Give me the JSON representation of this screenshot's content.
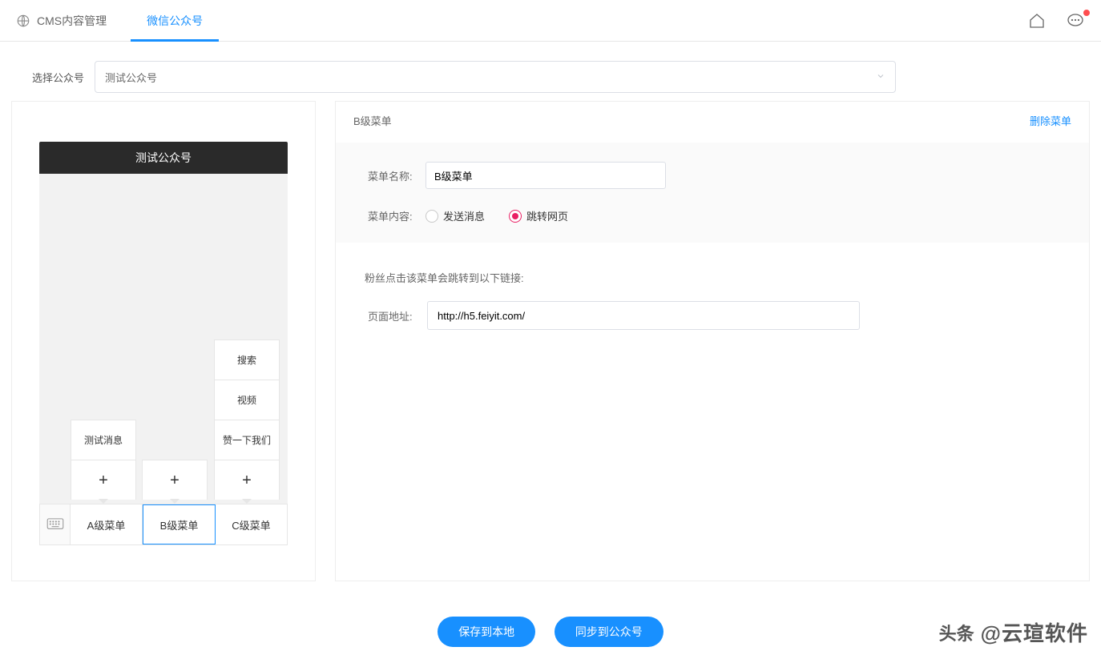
{
  "topbar": {
    "breadcrumb": "CMS内容管理",
    "active_tab": "微信公众号"
  },
  "selector": {
    "label": "选择公众号",
    "value": "测试公众号"
  },
  "phone": {
    "title": "测试公众号",
    "main_menus": [
      "A级菜单",
      "B级菜单",
      "C级菜单"
    ],
    "active_index": 1,
    "submenus": {
      "col0": [
        "测试消息"
      ],
      "col1": [],
      "col2": [
        "搜索",
        "视频",
        "赞一下我们"
      ]
    },
    "add_symbol": "+"
  },
  "detail": {
    "title": "B级菜单",
    "delete_label": "删除菜单",
    "form": {
      "name_label": "菜单名称:",
      "name_value": "B级菜单",
      "content_label": "菜单内容:",
      "radio_send": "发送消息",
      "radio_jump": "跳转网页"
    },
    "link": {
      "hint": "粉丝点击该菜单会跳转到以下链接:",
      "label": "页面地址:",
      "value": "http://h5.feiyit.com/"
    }
  },
  "buttons": {
    "save": "保存到本地",
    "sync": "同步到公众号"
  },
  "watermark": {
    "prefix": "头条",
    "text": "@云瑄软件"
  }
}
